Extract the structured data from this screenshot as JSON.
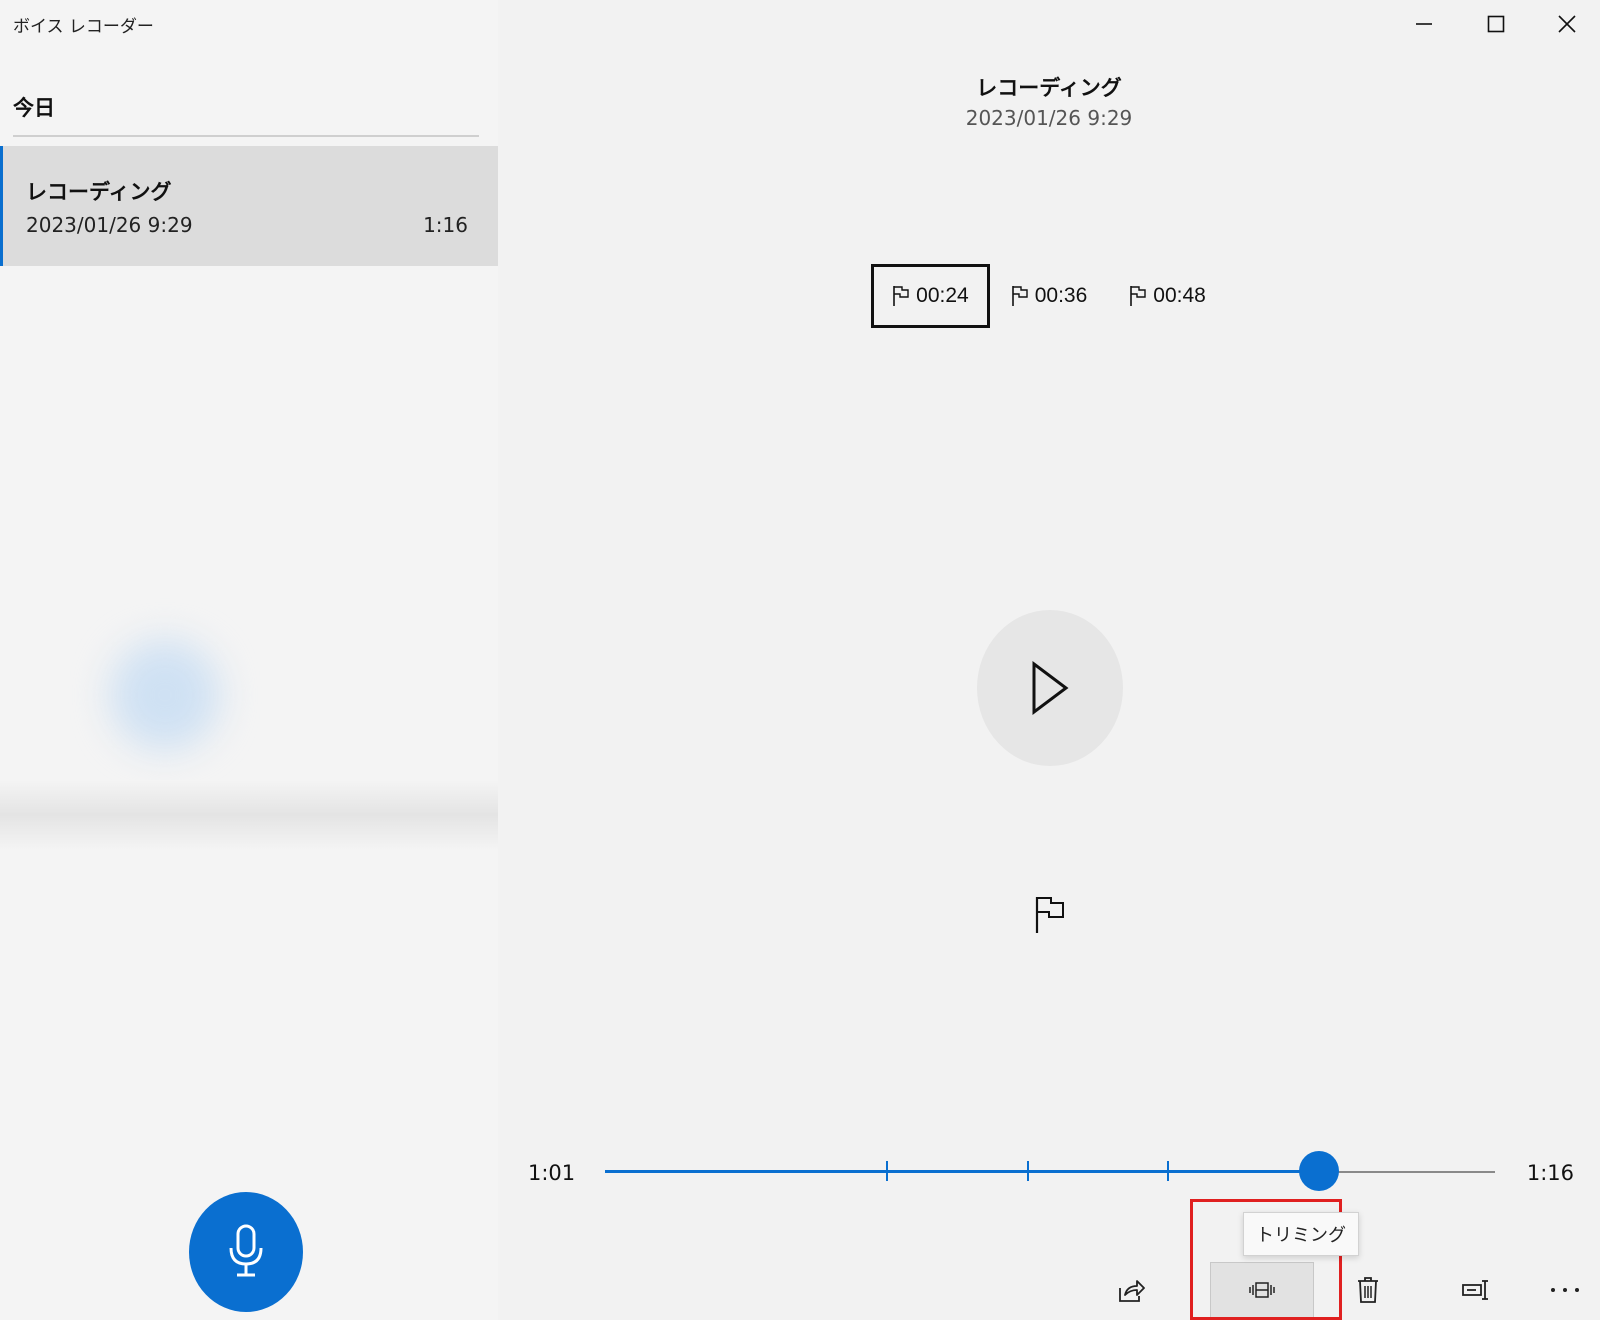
{
  "app": {
    "title": "ボイス レコーダー"
  },
  "window_controls": {
    "minimize_icon": "minimize-icon",
    "maximize_icon": "maximize-icon",
    "close_icon": "close-icon"
  },
  "sidebar": {
    "group_header": "今日",
    "recordings": [
      {
        "title": "レコーディング",
        "date": "2023/01/26 9:29",
        "duration": "1:16",
        "selected": true
      }
    ]
  },
  "player": {
    "title": "レコーディング",
    "date": "2023/01/26 9:29",
    "markers": [
      {
        "label": "00:24",
        "selected": true
      },
      {
        "label": "00:36",
        "selected": false
      },
      {
        "label": "00:48",
        "selected": false
      }
    ],
    "current_time": "1:01",
    "total_time": "1:16",
    "progress_seconds": 61,
    "duration_seconds": 76,
    "marker_seconds": [
      24,
      36,
      48
    ]
  },
  "toolbar": {
    "tooltip": "トリミング",
    "buttons": [
      "share-icon",
      "trim-icon",
      "delete-icon",
      "rename-icon",
      "more-icon"
    ]
  },
  "colors": {
    "accent": "#0a6fd0",
    "highlight": "#e02020"
  }
}
